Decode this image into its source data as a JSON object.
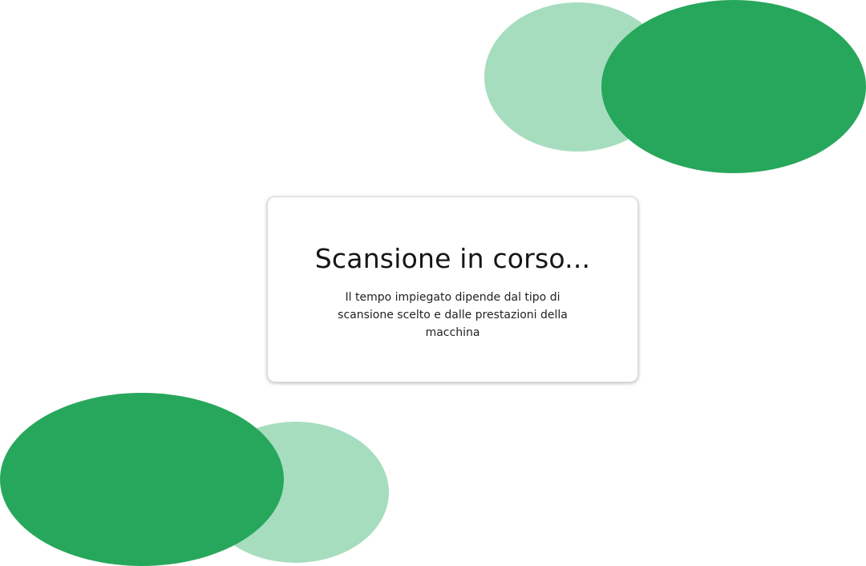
{
  "colors": {
    "green_dark": "#27a75b",
    "green_light": "#a7ddbf",
    "background": "#ffffff"
  },
  "dialog": {
    "title": "Scansione in corso...",
    "message": "Il tempo impiegato dipende dal tipo di scansione scelto e dalle prestazioni della macchina"
  }
}
